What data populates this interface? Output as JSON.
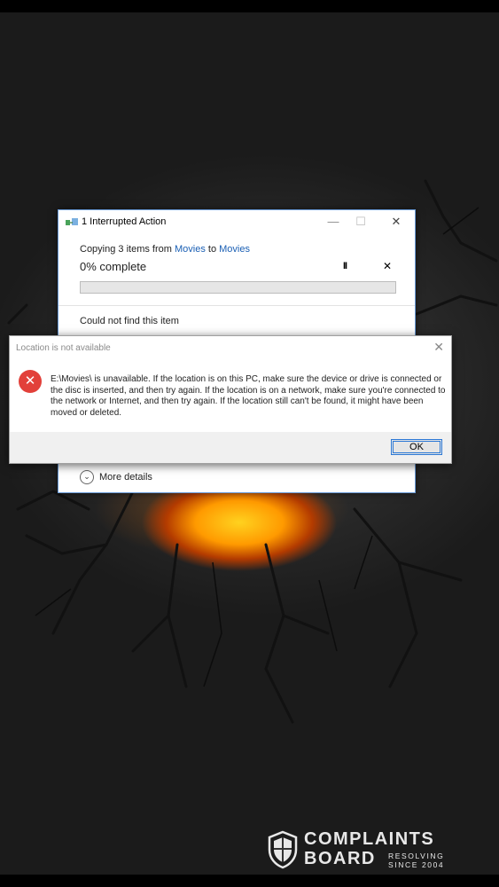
{
  "copy_dialog": {
    "title": "1 Interrupted Action",
    "minimize": "—",
    "maximize": "☐",
    "close": "✕",
    "copying_prefix": "Copying 3 items from ",
    "source": "Movies",
    "to_word": " to ",
    "destination": "Movies",
    "percent": "0% complete",
    "progress": 0,
    "pause_icon": "II",
    "cancel_icon": "✕",
    "status": "Could not find this item",
    "more_details": "More details"
  },
  "error_dialog": {
    "title": "Location is not available",
    "close": "✕",
    "message": "E:\\Movies\\ is unavailable. If the location is on this PC, make sure the device or drive is connected or the disc is inserted, and then try again. If the location is on a network, make sure you're connected to the network or Internet, and then try again. If the location still can't be found, it might have been moved or deleted.",
    "ok": "OK"
  },
  "watermark": {
    "line1": "COMPLAINTS",
    "line2": "BOARD",
    "tag1": "RESOLVING",
    "tag2": "SINCE 2004"
  },
  "colors": {
    "error_red": "#e2403a",
    "link_blue": "#1a5fb4",
    "ok_border": "#2b78d6"
  }
}
